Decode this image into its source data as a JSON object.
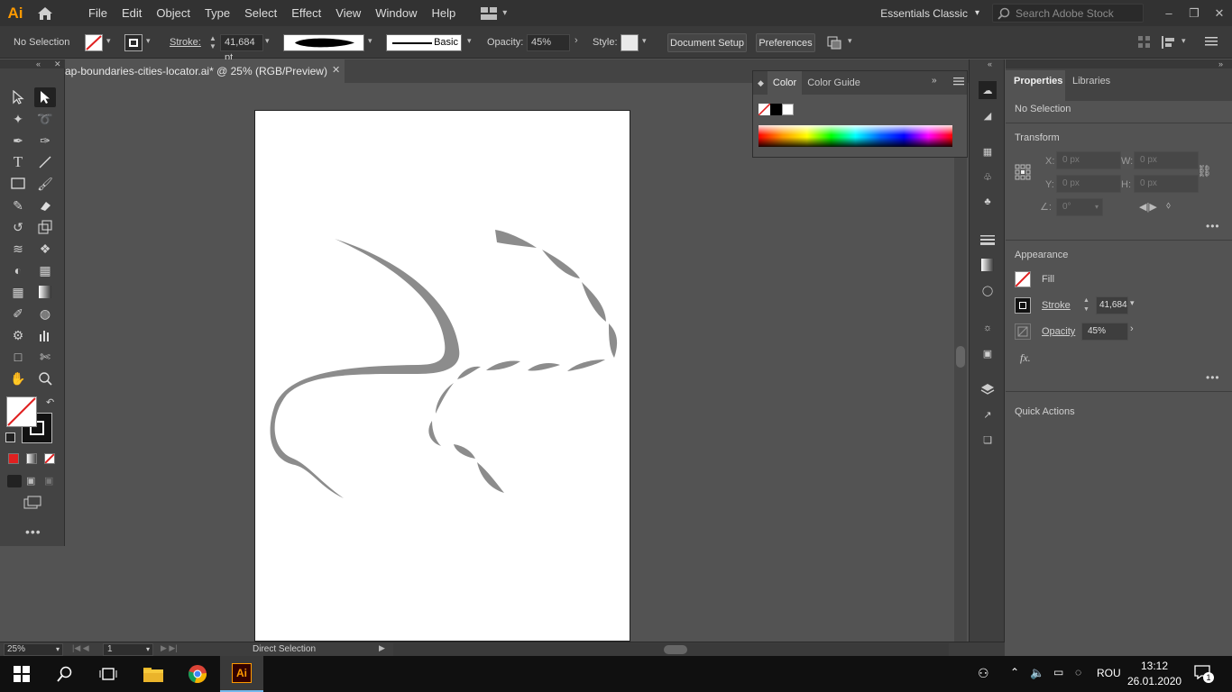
{
  "app": {
    "logo": "Ai"
  },
  "menu": {
    "items": [
      "File",
      "Edit",
      "Object",
      "Type",
      "Select",
      "Effect",
      "View",
      "Window",
      "Help"
    ]
  },
  "workspace": {
    "label": "Essentials Classic"
  },
  "search": {
    "placeholder": "Search Adobe Stock"
  },
  "control": {
    "selection": "No Selection",
    "stroke_label": "Stroke:",
    "stroke_value": "41,684 pt",
    "brush_label": "Basic",
    "opacity_label": "Opacity:",
    "opacity_value": "45%",
    "style_label": "Style:",
    "document_setup": "Document Setup",
    "preferences": "Preferences"
  },
  "document": {
    "tab_title": "ap-boundaries-cities-locator.ai* @ 25% (RGB/Preview)"
  },
  "color_panel": {
    "tab_color": "Color",
    "tab_guide": "Color Guide"
  },
  "properties": {
    "tab_properties": "Properties",
    "tab_libraries": "Libraries",
    "selection": "No Selection",
    "transform_title": "Transform",
    "x_label": "X:",
    "x_value": "0 px",
    "y_label": "Y:",
    "y_value": "0 px",
    "w_label": "W:",
    "w_value": "0 px",
    "h_label": "H:",
    "h_value": "0 px",
    "angle_value": "0°",
    "appearance_title": "Appearance",
    "fill_label": "Fill",
    "stroke_label": "Stroke",
    "stroke_value": "41,684",
    "opacity_label": "Opacity",
    "opacity_value": "45%",
    "fx_label": "fx.",
    "quick_actions": "Quick Actions"
  },
  "status": {
    "zoom": "25%",
    "artboard_num": "1",
    "tool": "Direct Selection"
  },
  "taskbar": {
    "lang": "ROU",
    "time": "13:12",
    "date": "26.01.2020",
    "notif_count": "1"
  },
  "colors": {
    "accent_orange": "#ff9a00",
    "ui_dark": "#323232",
    "panel": "#535353",
    "artwork_gray": "#8c8c8c"
  }
}
